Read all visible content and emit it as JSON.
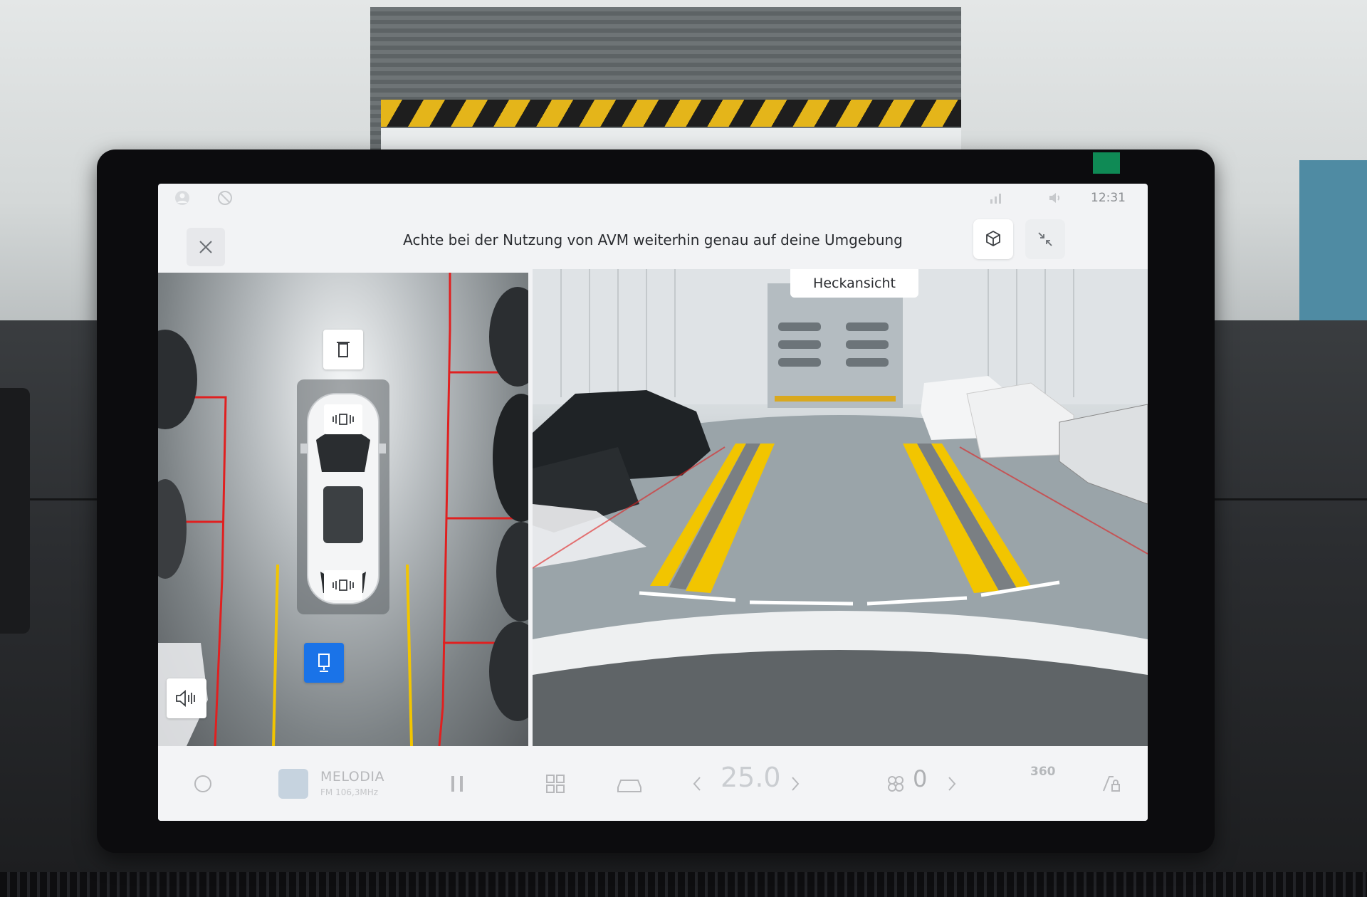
{
  "status_bar": {
    "time": "12:31",
    "icons": [
      "profile-icon",
      "no-signal-icon",
      "signal-off-icon",
      "volume-icon"
    ]
  },
  "header": {
    "close_icon": "close-icon",
    "title": "Achte bei der Nutzung von AVM weiterhin genau auf deine Umgebung",
    "buttons": [
      "3d-view-icon",
      "minimize-icon"
    ]
  },
  "camera": {
    "view_label": "Heckansicht",
    "birdseye_controls": [
      {
        "name": "front-camera-button",
        "icon": "front-camera-icon",
        "active": false
      },
      {
        "name": "rear-camera-button",
        "icon": "rear-camera-icon",
        "active": true
      },
      {
        "name": "parking-sound-button",
        "icon": "sound-wave-icon",
        "active": false
      }
    ],
    "sensor_badges": [
      "front-sensor-icon",
      "rear-sensor-icon"
    ],
    "colors": {
      "guide_yellow": "#f2c500",
      "guide_white": "#ffffff",
      "boundary_red": "#e02020",
      "active_blue": "#1a73e8"
    }
  },
  "dock": {
    "home_icon": "home-icon",
    "media": {
      "title": "MELODIA",
      "subtitle": "FM 106,3MHz"
    },
    "pause_icon": "pause-icon",
    "apps_icon": "apps-grid-icon",
    "car_icon": "car-icon",
    "temperature": "25.0",
    "fan_level": "0",
    "btn_360": "360",
    "park_lock_icon": "park-lock-icon"
  }
}
